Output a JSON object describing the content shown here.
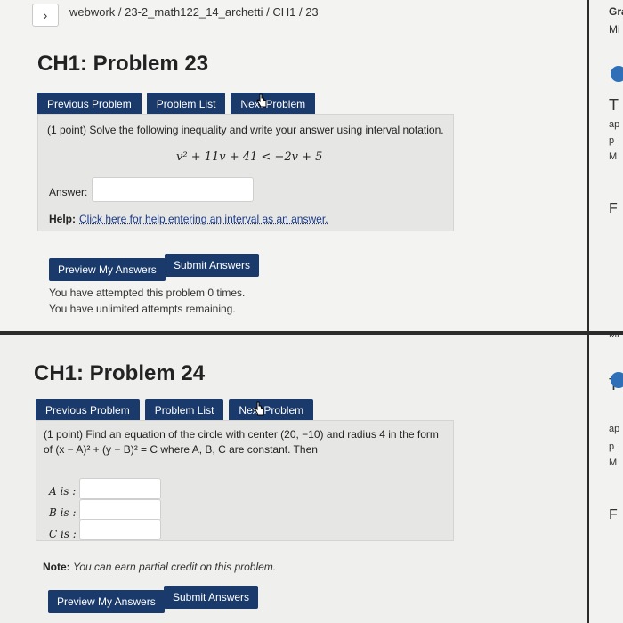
{
  "breadcrumb": {
    "path": "webwork / 23-2_math122_14_archetti / CH1 / 23"
  },
  "right_panel_top": {
    "line1": "Gra",
    "line2": "Mi",
    "line3": "T",
    "line4": "ap",
    "line5": "p",
    "line6": "M",
    "line7": "F"
  },
  "right_panel_bottom": {
    "line1": "Mi",
    "line2": "T",
    "line3": "ap",
    "line4": "p",
    "line5": "M",
    "line6": "F"
  },
  "problem23": {
    "title": "CH1: Problem 23",
    "tabs": [
      "Previous Problem",
      "Problem List",
      "Next Problem"
    ],
    "prompt": "(1 point) Solve the following inequality and write your answer using interval notation.",
    "equation": "v² + 11v + 41 < −2v + 5",
    "answer_label": "Answer:",
    "answer_value": "",
    "help_label": "Help:",
    "help_link": "Click here for help entering an interval as an answer.",
    "preview_button": "Preview My Answers",
    "submit_button": "Submit Answers",
    "status_line1": "You have attempted this problem 0 times.",
    "status_line2": "You have unlimited attempts remaining."
  },
  "problem24": {
    "title": "CH1: Problem 24",
    "tabs": [
      "Previous Problem",
      "Problem List",
      "Next Problem"
    ],
    "prompt_line1": "(1 point) Find an equation of the circle with center (20, −10) and radius 4 in the form",
    "prompt_line2": "of (x − A)² + (y − B)² = C where A, B, C are constant. Then",
    "fields": [
      {
        "label": "A is :",
        "value": ""
      },
      {
        "label": "B is :",
        "value": ""
      },
      {
        "label": "C is :",
        "value": ""
      }
    ],
    "note_label": "Note:",
    "note_text": "You can earn partial credit on this problem.",
    "preview_button": "Preview My Answers",
    "submit_button": "Submit Answers"
  }
}
